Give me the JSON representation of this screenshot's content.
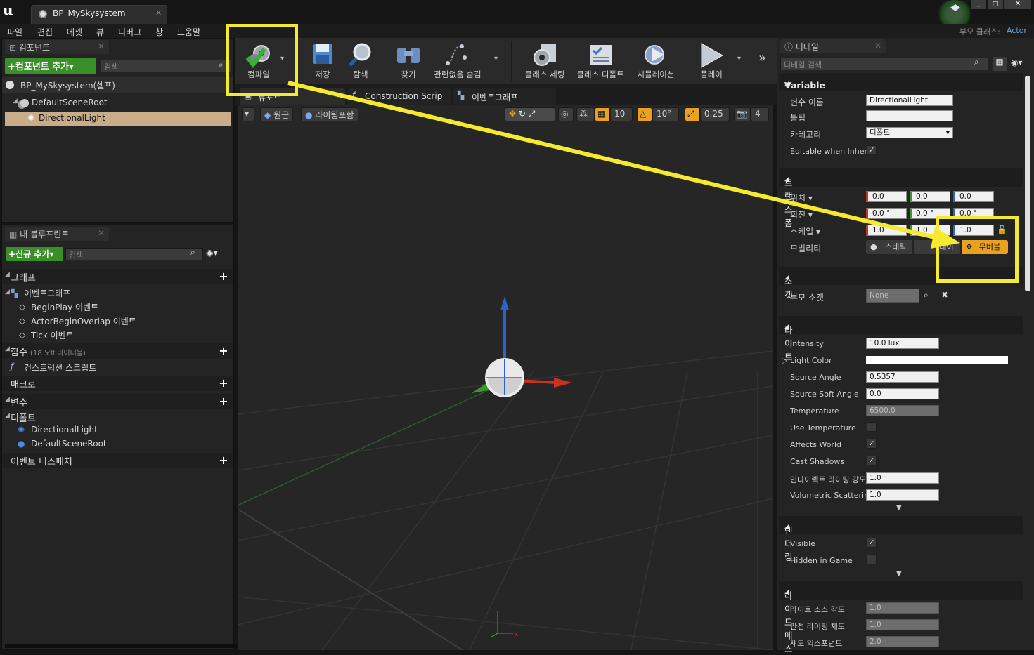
{
  "window": {
    "tab_title": "BP_MySkysystem",
    "parent_class_label": "부모 클래스:",
    "parent_class_value": "Actor"
  },
  "menu": [
    "파일",
    "편집",
    "에셋",
    "뷰",
    "디버그",
    "창",
    "도움말"
  ],
  "components_panel": {
    "tab": "컴포넌트",
    "add_button": "컴포넌트 추가",
    "search_placeholder": "검색",
    "self_item": "BP_MySkysystem(셀프)",
    "tree": [
      "DefaultSceneRoot",
      "DirectionalLight"
    ]
  },
  "myblueprint_panel": {
    "tab": "내 블루프린트",
    "add_button": "신규 추가",
    "search_placeholder": "검색",
    "graph_section": "그래프",
    "event_graph": "이벤트그래프",
    "events": [
      "BeginPlay 이벤트",
      "ActorBeginOverlap 이벤트",
      "Tick 이벤트"
    ],
    "functions_section": "함수",
    "functions_note": "(18 오버라이더블)",
    "construction_script": "컨스트럭션 스크립트",
    "macros_section": "매크로",
    "variables_section": "변수",
    "default_category": "디폴트",
    "variables": [
      "DirectionalLight",
      "DefaultSceneRoot"
    ],
    "dispatchers_section": "이벤트 디스패처"
  },
  "toolbar": {
    "compile": "컴파일",
    "save": "저장",
    "browse": "탐색",
    "find": "찾기",
    "hide_unrelated": "관련없음 숨김",
    "class_settings": "클래스 세팅",
    "class_defaults": "클래스 디폴트",
    "simulation": "시뮬레이션",
    "play": "플레이"
  },
  "editor_tabs": [
    "뷰포트",
    "Construction Scrip",
    "이벤트그래프"
  ],
  "viewport": {
    "perspective": "원근",
    "lighting": "라이팅포함",
    "grid_snap": "10",
    "rot_snap": "10°",
    "scale_snap": "0.25",
    "cam_speed": "4"
  },
  "details": {
    "tab": "디테일",
    "search_placeholder": "디테일 검색",
    "variable": {
      "section": "Variable",
      "name_label": "변수 이름",
      "name_value": "DirectionalLight",
      "tooltip_label": "툴팁",
      "tooltip_value": "",
      "category_label": "카테고리",
      "category_value": "디폴트",
      "editable_label": "Editable when Inherit"
    },
    "transform": {
      "section": "트랜스폼",
      "location_label": "위치",
      "location": [
        "0.0",
        "0.0",
        "0.0"
      ],
      "rotation_label": "회전",
      "rotation": [
        "0.0 °",
        "0.0 °",
        "0.0 °"
      ],
      "scale_label": "스케일",
      "scale": [
        "1.0",
        "1.0",
        "1.0"
      ],
      "mobility_label": "모빌리티",
      "mobility_static": "스태틱",
      "mobility_stationary": "스테이.",
      "mobility_movable": "무버블"
    },
    "sockets": {
      "section": "소켓",
      "parent_socket_label": "부모 소켓",
      "parent_socket_value": "None"
    },
    "light": {
      "section": "라이트",
      "intensity_label": "Intensity",
      "intensity": "10.0 lux",
      "light_color_label": "Light Color",
      "source_angle_label": "Source Angle",
      "source_angle": "0.5357",
      "source_soft_angle_label": "Source Soft Angle",
      "source_soft_angle": "0.0",
      "temperature_label": "Temperature",
      "temperature": "6500.0",
      "use_temperature_label": "Use Temperature",
      "affects_world_label": "Affects World",
      "cast_shadows_label": "Cast Shadows",
      "indirect_label": "인다이렉트 라이팅 강도",
      "indirect": "1.0",
      "volumetric_label": "Volumetric Scatterin",
      "volumetric": "1.0"
    },
    "rendering": {
      "section": "렌더링",
      "visible_label": "Visible",
      "hidden_label": "Hidden in Game"
    },
    "lightmass": {
      "section": "라이트매스",
      "source_angle_label": "라이트 소스 각도",
      "source_angle": "1.0",
      "indirect_sat_label": "간접 라이팅 채도",
      "indirect_sat": "1.0",
      "shadow_exp_label": "섀도 익스포넌트",
      "shadow_exp": "2.0"
    }
  },
  "colors": {
    "highlight": "#f5ea2e",
    "accent_orange": "#e8a21f",
    "accent_green": "#3a8f28",
    "selected_row": "#c8ad88"
  }
}
